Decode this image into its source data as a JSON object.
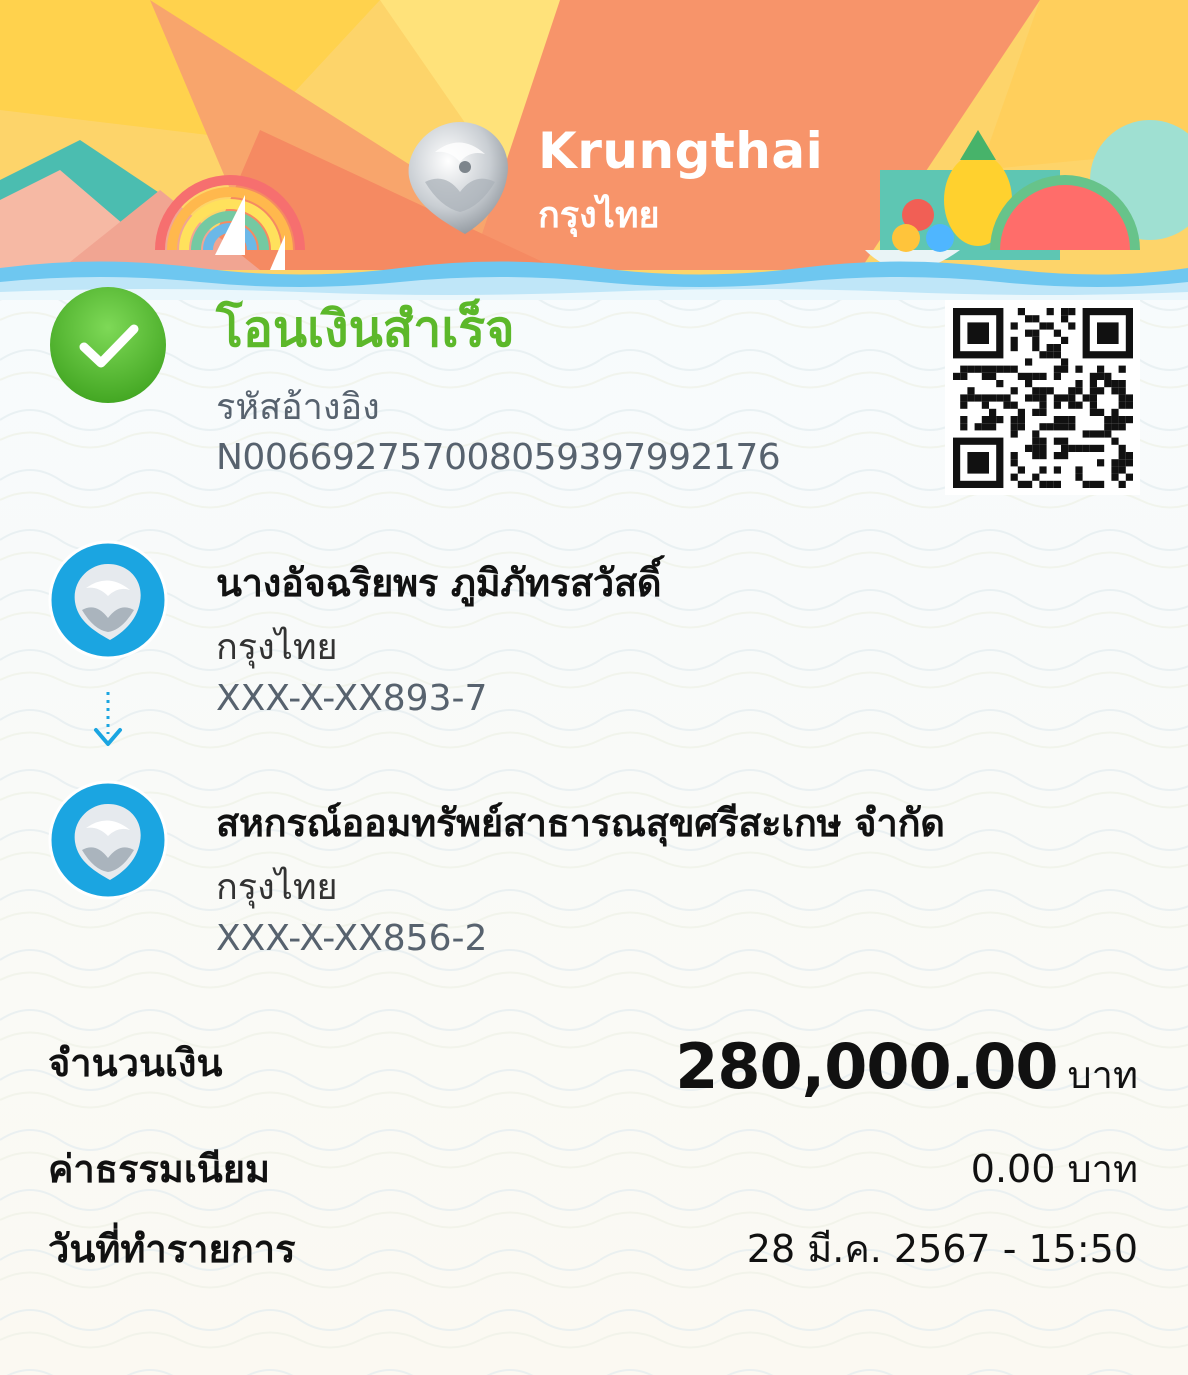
{
  "brand": {
    "name_en": "Krungthai",
    "name_th": "กรุงไทย"
  },
  "status": {
    "title": "โอนเงินสำเร็จ",
    "ref_label": "รหัสอ้างอิง",
    "ref_value": "N006692757008059397992176",
    "icon": "check-circle-icon"
  },
  "qr": {
    "icon": "qr-code-icon"
  },
  "sender": {
    "name": "นางอัจฉริยพร ภูมิภัทรสวัสดิ์",
    "bank": "กรุงไทย",
    "account": "XXX-X-XX893-7",
    "icon": "krungthai-logo-icon"
  },
  "receiver": {
    "name": "สหกรณ์ออมทรัพย์สาธารณสุขศรีสะเกษ จำกัด",
    "bank": "กรุงไทย",
    "account": "XXX-X-XX856-2",
    "icon": "krungthai-logo-icon"
  },
  "transfer_arrow": {
    "icon": "arrow-down-icon"
  },
  "details": {
    "amount_label": "จำนวนเงิน",
    "amount_value": "280,000.00",
    "amount_unit": "บาท",
    "fee_label": "ค่าธรรมเนียม",
    "fee_value": "0.00 บาท",
    "date_label": "วันที่ทำรายการ",
    "date_value": "28 มี.ค. 2567 - 15:50"
  },
  "colors": {
    "success_green": "#5cb82a",
    "brand_blue": "#1ba5e1",
    "header_orange": "#f58a62",
    "header_yellow": "#ffd45a"
  }
}
